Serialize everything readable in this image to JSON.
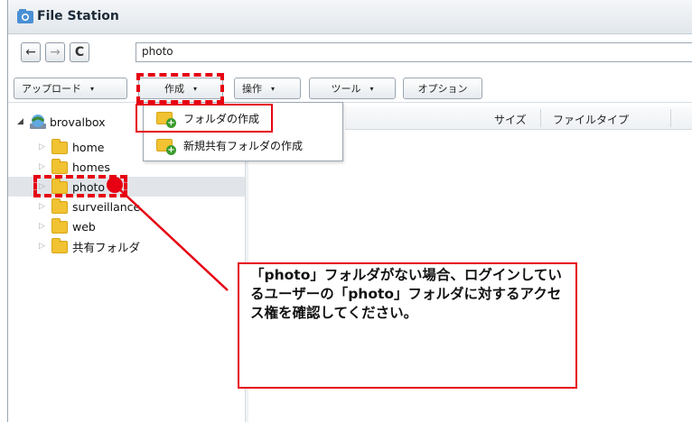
{
  "window": {
    "title": "File Station",
    "icon": "file-station-icon"
  },
  "nav": {
    "back_glyph": "←",
    "forward_glyph": "→",
    "refresh_glyph": "C",
    "path": "photo"
  },
  "toolbar": {
    "upload": "アップロード",
    "create": "作成",
    "action": "操作",
    "tools": "ツール",
    "options": "オプション",
    "caret": "▾"
  },
  "tree": {
    "root": "brovalbox",
    "items": [
      {
        "label": "home"
      },
      {
        "label": "homes"
      },
      {
        "label": "photo"
      },
      {
        "label": "surveillance"
      },
      {
        "label": "web"
      },
      {
        "label": "共有フォルダ"
      }
    ],
    "expander_glyph": "▷",
    "root_expander_glyph": "◢"
  },
  "list": {
    "headers": [
      "サイズ",
      "ファイルタイプ"
    ]
  },
  "create_menu": {
    "items": [
      {
        "label": "フォルダの作成"
      },
      {
        "label": "新規共有フォルダの作成"
      }
    ],
    "plus_glyph": "+"
  },
  "callout": {
    "text": "「photo」フォルダがない場合、ログインしているユーザーの「photo」フォルダに対するアクセス権を確認してください。"
  },
  "colors": {
    "annotation_red": "#e60012",
    "folder_yellow": "#f1c232",
    "plus_green": "#3a9b2d"
  }
}
